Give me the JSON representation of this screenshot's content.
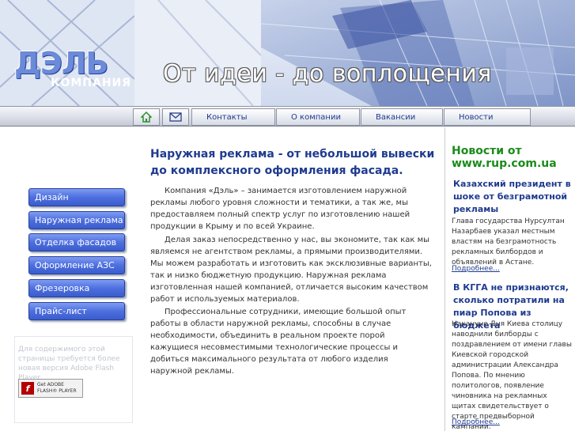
{
  "header": {
    "logo_text": "ДЭЛЬ",
    "logo_subtext": "КОМПАНИЯ",
    "slogan": "От идеи - до воплощения"
  },
  "nav": {
    "home_icon": "home-icon",
    "mail_icon": "mail-icon",
    "items": [
      {
        "label": "Контакты"
      },
      {
        "label": "О компании"
      },
      {
        "label": "Вакансии"
      },
      {
        "label": "Новости"
      }
    ]
  },
  "sidebar": {
    "items": [
      {
        "label": "Дизайн"
      },
      {
        "label": "Наружная реклама"
      },
      {
        "label": "Отделка фасадов"
      },
      {
        "label": "Оформление АЗС"
      },
      {
        "label": "Фрезеровка"
      },
      {
        "label": "Прайс-лист"
      }
    ],
    "flash_notice": "Для содержимого этой страницы требуется более новая версия Adobe Flash Player.",
    "flash_badge_line1": "Get ADOBE",
    "flash_badge_line2": "FLASH® PLAYER"
  },
  "content": {
    "heading": "Наружная реклама - от небольшой вывески до комплексного оформления фасада.",
    "paragraphs": [
      "Компания «Дэль» – занимается изготовлением наружной рекламы любого уровня сложности и тематики, а так же, мы предоставляем полный спектр услуг по изготовлению нашей продукции в Крыму и по всей Украине.",
      "Делая заказ непосредственно у нас, вы экономите, так как мы являемся не агентством рекламы, а прямыми производителями. Мы можем разработать и изготовить как эксклюзивные варианты, так и низко бюджетную продукцию. Наружная реклама изготовленная нашей компанией, отличается высоким качеством работ и используемых материалов.",
      "Профессиональные сотрудники, имеющие большой опыт работы в области наружной рекламы, способны в случае необходимости, объединить в реальном проекте порой кажущиеся несовместимыми технологические процессы и добиться максимального результата от любого изделия наружной рекламы."
    ]
  },
  "news": {
    "title": "Новости от www.rup.com.ua",
    "items": [
      {
        "headline": "Казахский президент в шоке от безграмотной рекламы",
        "text": "Глава государства Нурсултан Назарбаев указал местным властям на безграмотность рекламных билбордов и объявлений в Астане.",
        "more": "Подробнее..."
      },
      {
        "headline": "В КГГА не признаются, сколько потратили на пиар Попова из бюджета",
        "text": "Накануне Дня Киева столицу наводнили билборды с поздравлением от имени главы Киевской городской администрации Александра Попова. По мнению политологов, появление чиновника на рекламных щитах свидетельствует о старте предвыборной кампании.",
        "more": "Подробнее..."
      }
    ]
  },
  "colors": {
    "accent": "#1f3b8f",
    "news_title": "#1a8b1a",
    "sidebar_button": "#4d6fdf"
  }
}
